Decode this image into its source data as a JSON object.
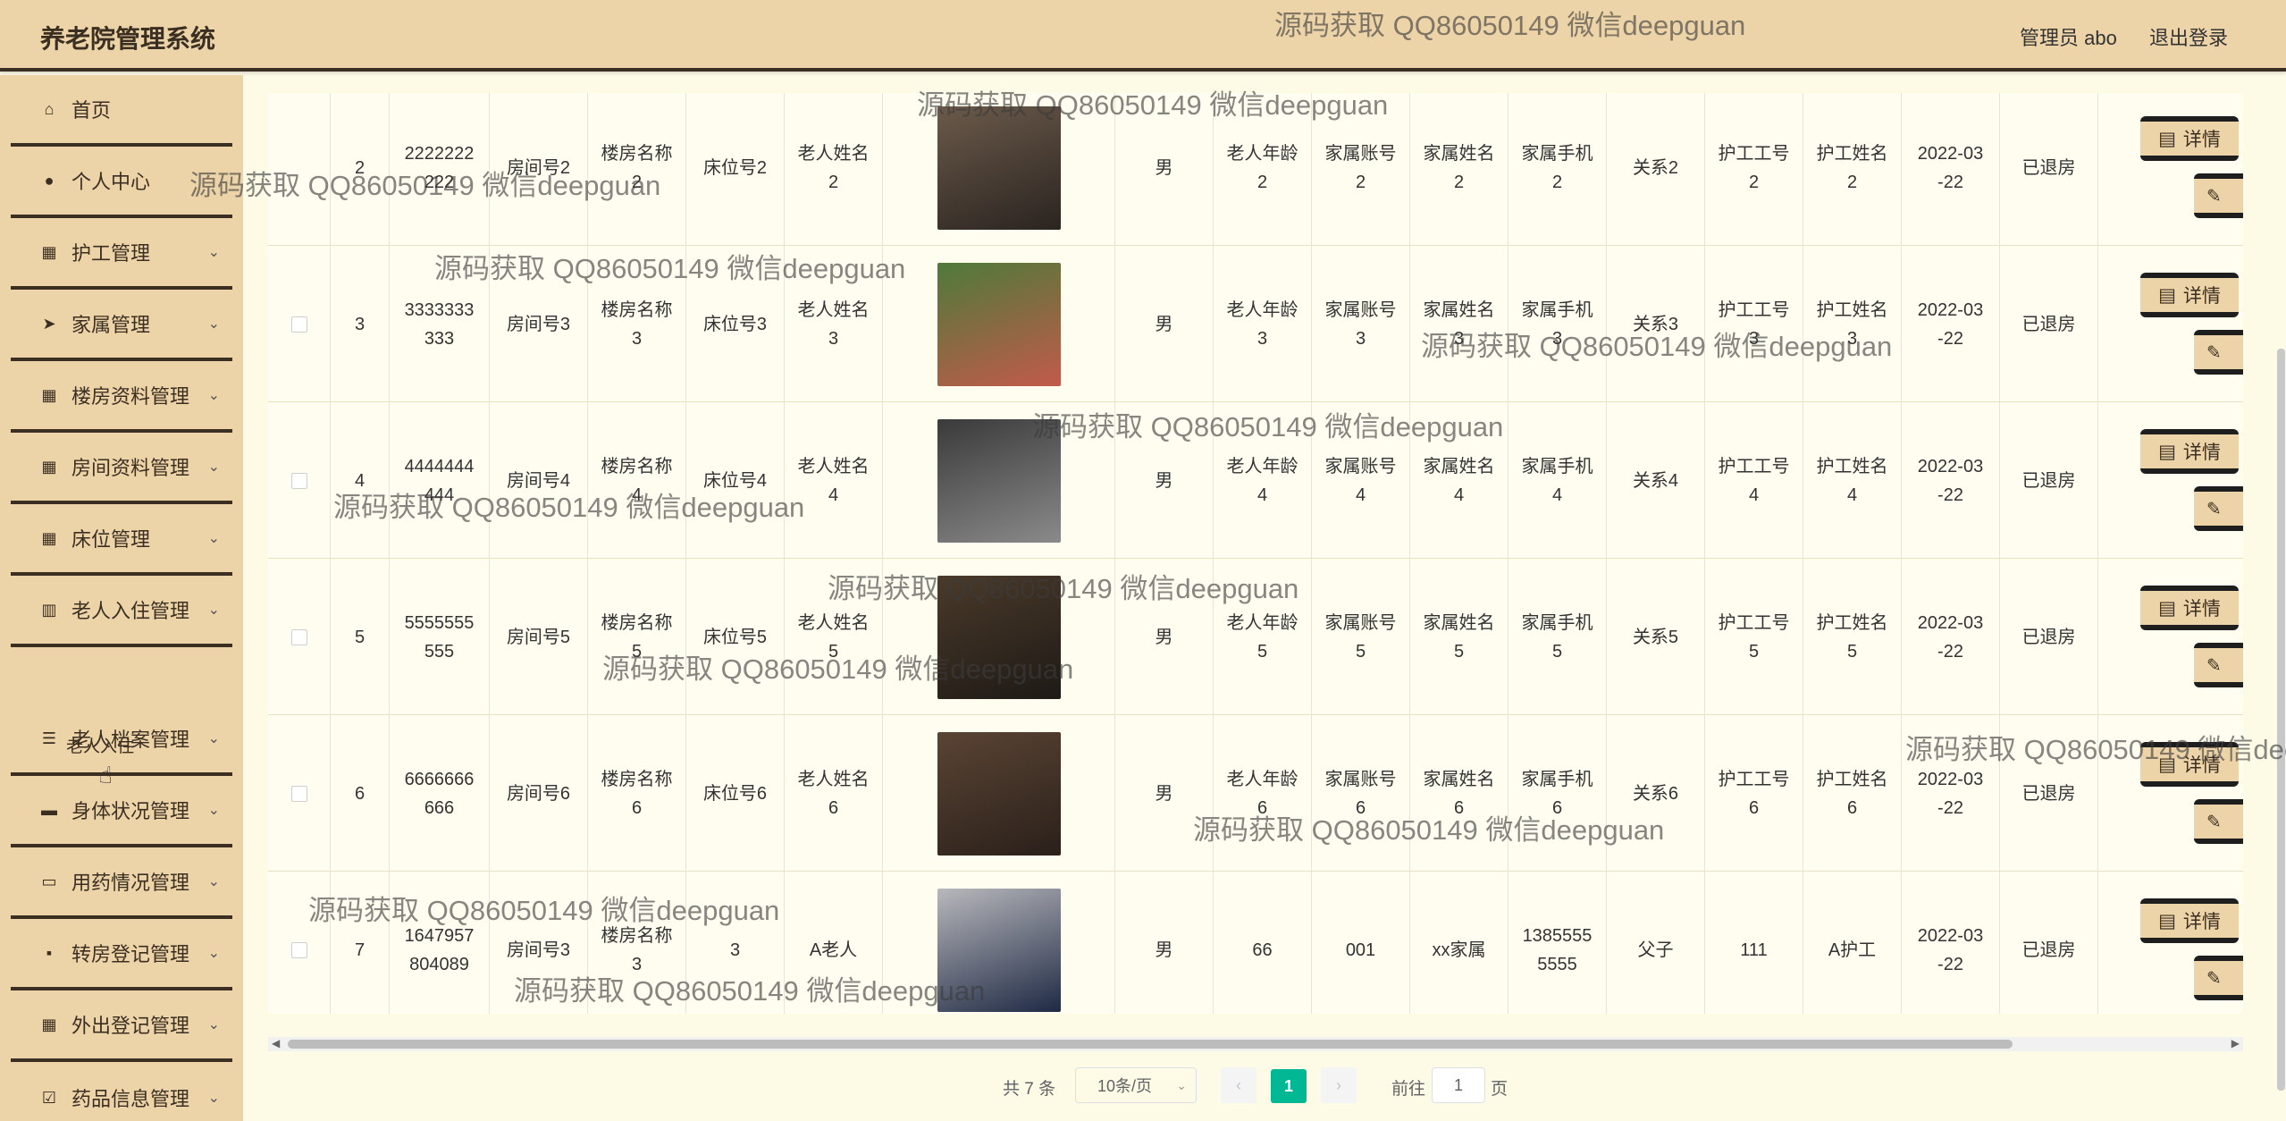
{
  "header": {
    "title": "养老院管理系统",
    "admin": "管理员 abo",
    "logout": "退出登录"
  },
  "sidebar": {
    "items": [
      {
        "label": "首页",
        "icon": "home-icon",
        "glyph": "⌂",
        "chevron": false
      },
      {
        "label": "个人中心",
        "icon": "user-icon",
        "glyph": "●",
        "chevron": false
      },
      {
        "label": "护工管理",
        "icon": "grid-icon",
        "glyph": "▦",
        "chevron": true
      },
      {
        "label": "家属管理",
        "icon": "send-icon",
        "glyph": "➤",
        "chevron": true
      },
      {
        "label": "楼房资料管理",
        "icon": "grid-icon",
        "glyph": "▦",
        "chevron": true
      },
      {
        "label": "房间资料管理",
        "icon": "grid-icon",
        "glyph": "▦",
        "chevron": true
      },
      {
        "label": "床位管理",
        "icon": "grid-icon",
        "glyph": "▦",
        "chevron": true
      },
      {
        "label": "老人入住管理",
        "icon": "chart-icon",
        "glyph": "▥",
        "chevron": true
      },
      {
        "label": "老人档案管理",
        "icon": "list-icon",
        "glyph": "☰",
        "chevron": true
      },
      {
        "label": "身体状况管理",
        "icon": "monitor-icon",
        "glyph": "▬",
        "chevron": true
      },
      {
        "label": "用药情况管理",
        "icon": "ticket-icon",
        "glyph": "▭",
        "chevron": true
      },
      {
        "label": "转房登记管理",
        "icon": "message-icon",
        "glyph": "▪",
        "chevron": true
      },
      {
        "label": "外出登记管理",
        "icon": "grid-icon",
        "glyph": "▦",
        "chevron": true
      },
      {
        "label": "药品信息管理",
        "icon": "checklist-icon",
        "glyph": "☑",
        "chevron": true
      }
    ],
    "sub_item": "老人入住"
  },
  "table": {
    "rows": [
      {
        "index": "2",
        "account": "2222222\n222",
        "room": "房间号2",
        "building": "楼房名称\n2",
        "bed": "床位号2",
        "name": "老人姓名\n2",
        "gender": "男",
        "age": "老人年龄\n2",
        "family_account": "家属账号\n2",
        "family_name": "家属姓名\n2",
        "family_phone": "家属手机\n2",
        "relation": "关系2",
        "nurse_no": "护工工号\n2",
        "nurse_name": "护工姓名\n2",
        "date": "2022-03\n-22",
        "status": "已退房"
      },
      {
        "index": "3",
        "account": "3333333\n333",
        "room": "房间号3",
        "building": "楼房名称\n3",
        "bed": "床位号3",
        "name": "老人姓名\n3",
        "gender": "男",
        "age": "老人年龄\n3",
        "family_account": "家属账号\n3",
        "family_name": "家属姓名\n3",
        "family_phone": "家属手机\n3",
        "relation": "关系3",
        "nurse_no": "护工工号\n3",
        "nurse_name": "护工姓名\n3",
        "date": "2022-03\n-22",
        "status": "已退房"
      },
      {
        "index": "4",
        "account": "4444444\n444",
        "room": "房间号4",
        "building": "楼房名称\n4",
        "bed": "床位号4",
        "name": "老人姓名\n4",
        "gender": "男",
        "age": "老人年龄\n4",
        "family_account": "家属账号\n4",
        "family_name": "家属姓名\n4",
        "family_phone": "家属手机\n4",
        "relation": "关系4",
        "nurse_no": "护工工号\n4",
        "nurse_name": "护工姓名\n4",
        "date": "2022-03\n-22",
        "status": "已退房"
      },
      {
        "index": "5",
        "account": "5555555\n555",
        "room": "房间号5",
        "building": "楼房名称\n5",
        "bed": "床位号5",
        "name": "老人姓名\n5",
        "gender": "男",
        "age": "老人年龄\n5",
        "family_account": "家属账号\n5",
        "family_name": "家属姓名\n5",
        "family_phone": "家属手机\n5",
        "relation": "关系5",
        "nurse_no": "护工工号\n5",
        "nurse_name": "护工姓名\n5",
        "date": "2022-03\n-22",
        "status": "已退房"
      },
      {
        "index": "6",
        "account": "6666666\n666",
        "room": "房间号6",
        "building": "楼房名称\n6",
        "bed": "床位号6",
        "name": "老人姓名\n6",
        "gender": "男",
        "age": "老人年龄\n6",
        "family_account": "家属账号\n6",
        "family_name": "家属姓名\n6",
        "family_phone": "家属手机\n6",
        "relation": "关系6",
        "nurse_no": "护工工号\n6",
        "nurse_name": "护工姓名\n6",
        "date": "2022-03\n-22",
        "status": "已退房"
      },
      {
        "index": "7",
        "account": "1647957\n804089",
        "room": "房间号3",
        "building": "楼房名称\n3",
        "bed": "3",
        "name": "A老人",
        "gender": "男",
        "age": "66",
        "family_account": "001",
        "family_name": "xx家属",
        "family_phone": "1385555\n5555",
        "relation": "父子",
        "nurse_no": "111",
        "nurse_name": "A护工",
        "date": "2022-03\n-22",
        "status": "已退房"
      }
    ],
    "detail_label": "详情",
    "edit_label": "修"
  },
  "pagination": {
    "total": "共 7 条",
    "page_size": "10条/页",
    "current_page": "1",
    "goto_label": "前往",
    "goto_value": "1",
    "page_unit": "页"
  },
  "watermark": "源码获取 QQ86050149 微信deepguan",
  "colors": {
    "header_bg": "#ecd3a8",
    "content_bg": "#fdfbe6",
    "accent": "#00b894",
    "divider": "#3a2f22"
  }
}
